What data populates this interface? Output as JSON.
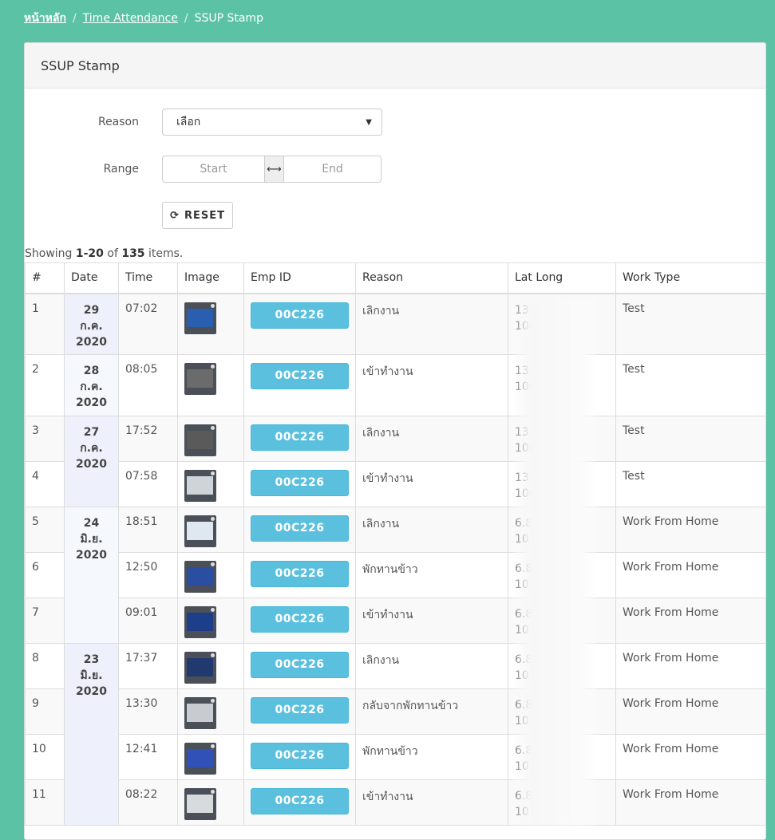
{
  "breadcrumb": {
    "home": "หน้าหลัก",
    "section": "Time Attendance",
    "current": "SSUP Stamp"
  },
  "panel": {
    "title": "SSUP Stamp"
  },
  "filters": {
    "reason_label": "Reason",
    "reason_value": "เลือก",
    "range_label": "Range",
    "range_start_placeholder": "Start",
    "range_end_placeholder": "End",
    "reset_label": "RESET"
  },
  "summary": {
    "prefix": "Showing ",
    "range": "1-20",
    "of": " of ",
    "total": "135",
    "suffix": " items."
  },
  "table": {
    "headers": [
      "#",
      "Date",
      "Time",
      "Image",
      "Emp ID",
      "Reason",
      "Lat Long",
      "Work Type"
    ],
    "rows": [
      {
        "no": "1",
        "time": "07:02",
        "emp": "00C226",
        "reason": "เลิกงาน",
        "lat": "13.7",
        "long": "100.",
        "type": "Test"
      },
      {
        "no": "2",
        "time": "08:05",
        "emp": "00C226",
        "reason": "เข้าทำงาน",
        "lat": "13.7",
        "long": "100.",
        "type": "Test"
      },
      {
        "no": "3",
        "time": "17:52",
        "emp": "00C226",
        "reason": "เลิกงาน",
        "lat": "13.7",
        "long": "100.",
        "type": "Test"
      },
      {
        "no": "4",
        "time": "07:58",
        "emp": "00C226",
        "reason": "เข้าทำงาน",
        "lat": "13.7",
        "long": "100.",
        "type": "Test"
      },
      {
        "no": "5",
        "time": "18:51",
        "emp": "00C226",
        "reason": "เลิกงาน",
        "lat": "6.81",
        "long": "101.",
        "type": "Work From Home"
      },
      {
        "no": "6",
        "time": "12:50",
        "emp": "00C226",
        "reason": "พักทานข้าว",
        "lat": "6.81",
        "long": "101.",
        "type": "Work From Home"
      },
      {
        "no": "7",
        "time": "09:01",
        "emp": "00C226",
        "reason": "เข้าทำงาน",
        "lat": "6.81",
        "long": "101.",
        "type": "Work From Home"
      },
      {
        "no": "8",
        "time": "17:37",
        "emp": "00C226",
        "reason": "เลิกงาน",
        "lat": "6.81",
        "long": "101.",
        "type": "Work From Home"
      },
      {
        "no": "9",
        "time": "13:30",
        "emp": "00C226",
        "reason": "กลับจากพักทานข้าว",
        "lat": "6.81",
        "long": "101.",
        "type": "Work From Home"
      },
      {
        "no": "10",
        "time": "12:41",
        "emp": "00C226",
        "reason": "พักทานข้าว",
        "lat": "6.81",
        "long": "101.",
        "type": "Work From Home"
      },
      {
        "no": "11",
        "time": "08:22",
        "emp": "00C226",
        "reason": "เข้าทำงาน",
        "lat": "6.81",
        "long": "101.",
        "type": "Work From Home"
      }
    ],
    "dates": [
      {
        "day": "29",
        "month": "ก.ค.",
        "year": "2020"
      },
      {
        "day": "28",
        "month": "ก.ค.",
        "year": "2020"
      },
      {
        "day": "27",
        "month": "ก.ค.",
        "year": "2020"
      },
      {
        "day": "24",
        "month": "มิ.ย.",
        "year": "2020"
      },
      {
        "day": "23",
        "month": "มิ.ย.",
        "year": "2020"
      }
    ]
  },
  "colors": {
    "background": "#5bc2a6",
    "emp_button": "#5bc0de"
  }
}
